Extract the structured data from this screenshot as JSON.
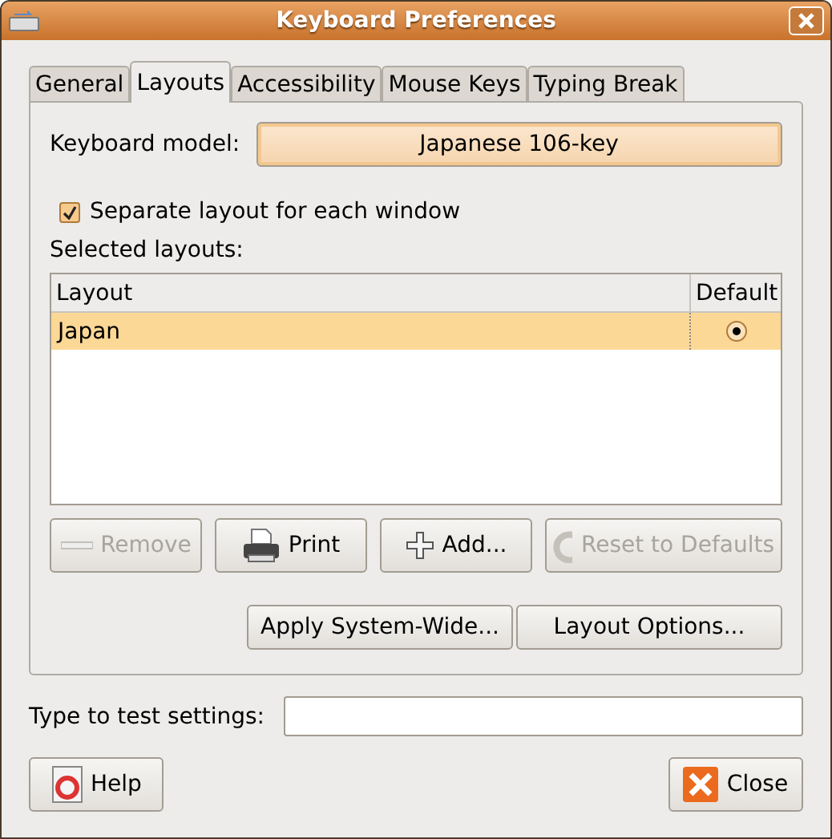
{
  "window": {
    "title": "Keyboard Preferences"
  },
  "tabs": [
    {
      "label": "General",
      "selected": false
    },
    {
      "label": "Layouts",
      "selected": true
    },
    {
      "label": "Accessibility",
      "selected": false
    },
    {
      "label": "Mouse Keys",
      "selected": false
    },
    {
      "label": "Typing Break",
      "selected": false
    }
  ],
  "keyboard_model": {
    "label": "Keyboard model:",
    "value": "Japanese 106-key"
  },
  "separate_layout": {
    "label": "Separate layout for each window",
    "checked": true
  },
  "selected_layouts": {
    "label": "Selected layouts:",
    "columns": [
      "Layout",
      "Default"
    ],
    "rows": [
      {
        "layout": "Japan",
        "default": true,
        "selected": true
      }
    ]
  },
  "layout_buttons": [
    {
      "label": "Remove",
      "kind": "minus",
      "disabled": true
    },
    {
      "label": "Print",
      "kind": "printer",
      "disabled": false
    },
    {
      "label": "Add...",
      "kind": "plus",
      "disabled": false
    },
    {
      "label": "Reset to Defaults",
      "kind": "reload",
      "disabled": true
    }
  ],
  "option_buttons": [
    "Apply System-Wide...",
    "Layout Options..."
  ],
  "test_field": {
    "label": "Type to test settings:"
  },
  "footer_buttons": [
    {
      "label": "Help",
      "kind": "help"
    },
    {
      "label": "Close",
      "kind": "close"
    }
  ]
}
